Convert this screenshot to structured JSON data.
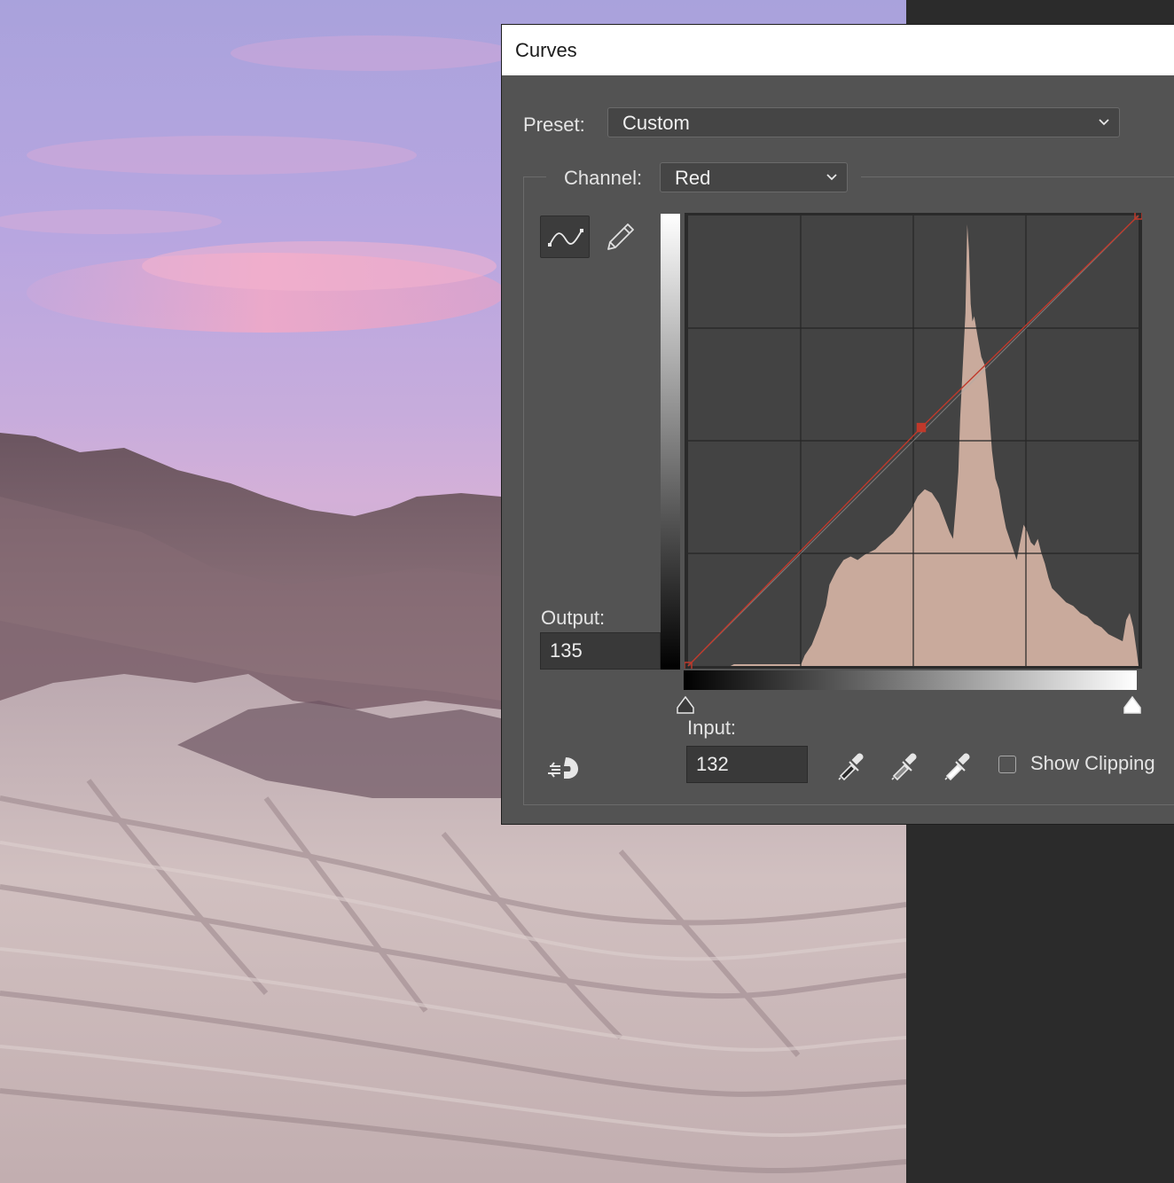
{
  "dialog": {
    "title": "Curves",
    "preset_label": "Preset:",
    "preset_value": "Custom",
    "channel_label": "Channel:",
    "channel_value": "Red",
    "output_label": "Output:",
    "output_value": "135",
    "input_label": "Input:",
    "input_value": "132",
    "show_clipping_label": "Show Clipping",
    "show_clipping_checked": false,
    "colors": {
      "curve": "#c0392b",
      "histogram": "#c9aa9c",
      "dialog_bg": "#535353",
      "graph_bg": "#434343"
    },
    "curve_points": [
      {
        "input": 0,
        "output": 0
      },
      {
        "input": 132,
        "output": 135
      },
      {
        "input": 255,
        "output": 255
      }
    ],
    "tools": [
      "curve-point-tool",
      "pencil-tool"
    ],
    "eyedroppers": [
      "black-point-eyedropper",
      "gray-point-eyedropper",
      "white-point-eyedropper"
    ]
  }
}
